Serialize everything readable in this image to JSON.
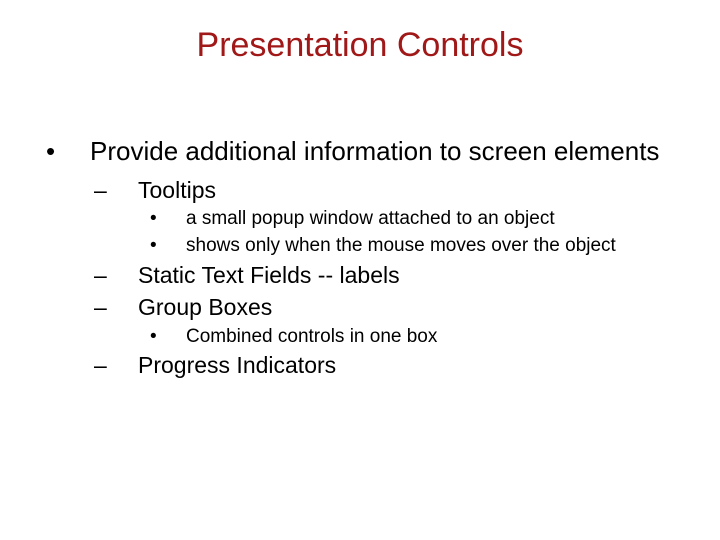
{
  "slide": {
    "title": "Presentation Controls",
    "l1_1": "Provide additional information to screen elements",
    "l2_1": "Tooltips",
    "l3_1": "a small popup window attached to an object",
    "l3_2": "shows only when the mouse moves over the object",
    "l2_2": "Static Text Fields  -- labels",
    "l2_3": "Group Boxes",
    "l3_3": "Combined controls in one box",
    "l2_4": "Progress Indicators",
    "bullets": {
      "dot": "•",
      "dash": "–"
    }
  }
}
